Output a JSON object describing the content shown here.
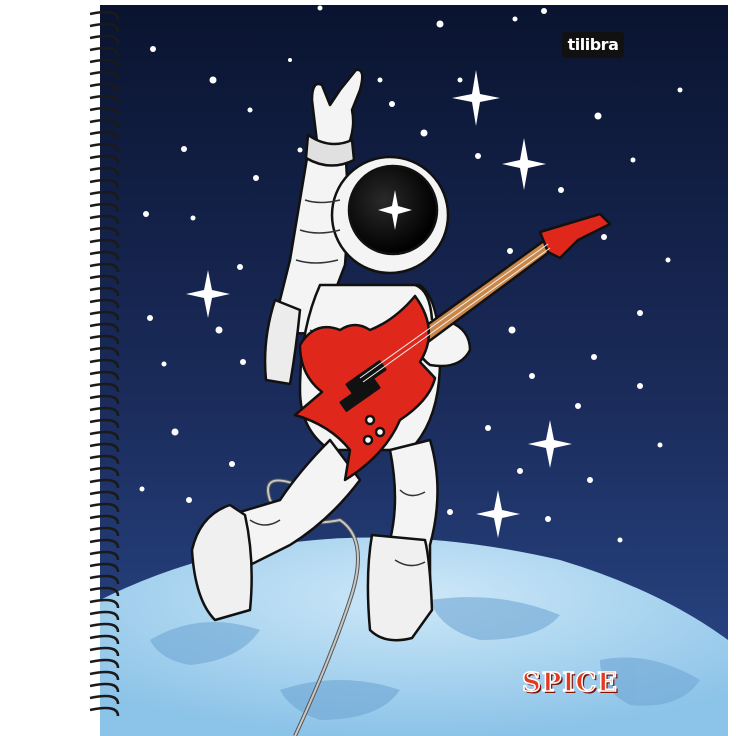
{
  "brand": {
    "logo_text": "tilibra"
  },
  "product": {
    "line_name": "SPICE"
  },
  "colors": {
    "space_top": "#0a1430",
    "space_mid": "#1b2c5c",
    "space_bottom": "#2a4a8c",
    "planet": "#9cccec",
    "guitar": "#e0271b",
    "suit": "#f4f4f4",
    "spiral": "#1a1a1a"
  },
  "illustration": {
    "subject": "astronaut-playing-guitar",
    "spiral_binding": "left-edge"
  }
}
